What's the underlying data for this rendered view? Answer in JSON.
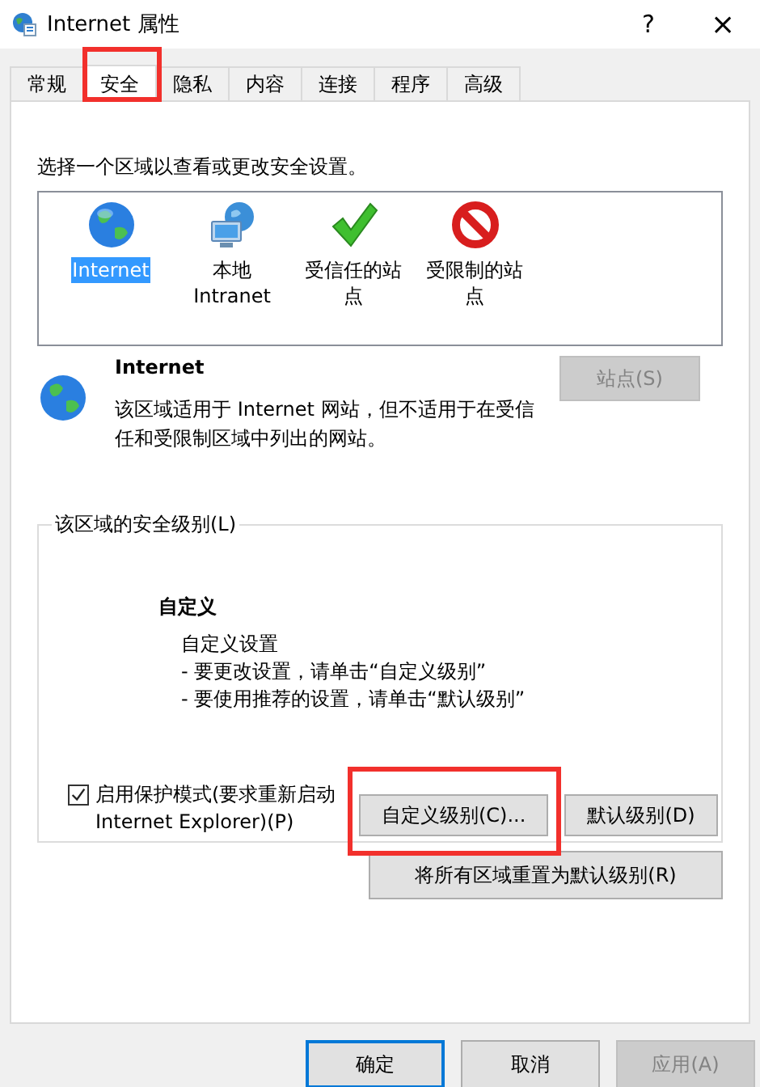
{
  "window": {
    "title": "Internet 属性",
    "help": "?",
    "close": "×"
  },
  "tabs": [
    {
      "label": "常规",
      "selected": false,
      "highlighted": false
    },
    {
      "label": "安全",
      "selected": true,
      "highlighted": true
    },
    {
      "label": "隐私",
      "selected": false,
      "highlighted": false
    },
    {
      "label": "内容",
      "selected": false,
      "highlighted": false
    },
    {
      "label": "连接",
      "selected": false,
      "highlighted": false
    },
    {
      "label": "程序",
      "selected": false,
      "highlighted": false
    },
    {
      "label": "高级",
      "selected": false,
      "highlighted": false
    }
  ],
  "instruction": "选择一个区域以查看或更改安全设置。",
  "zones": [
    {
      "kind": "internet",
      "label": "Internet",
      "selected": true
    },
    {
      "kind": "intranet",
      "label": "本地 Intranet",
      "selected": false
    },
    {
      "kind": "trusted",
      "label": "受信任的站点",
      "selected": false
    },
    {
      "kind": "restricted",
      "label": "受限制的站点",
      "selected": false
    }
  ],
  "zone_detail": {
    "kind": "internet",
    "title": "Internet",
    "description": "该区域适用于 Internet 网站，但不适用于在受信任和受限制区域中列出的网站。",
    "sites_button": {
      "label": "站点(S)",
      "disabled": true
    }
  },
  "security_level": {
    "legend": "该区域的安全级别(L)",
    "level_name": "自定义",
    "lines": [
      "自定义设置",
      "- 要更改设置，请单击“自定义级别”",
      "- 要使用推荐的设置，请单击“默认级别”"
    ],
    "protected_mode": {
      "label": "启用保护模式(要求重新启动 Internet Explorer)(P)",
      "checked": true
    },
    "buttons": [
      {
        "label": "自定义级别(C)...",
        "highlighted": true
      },
      {
        "label": "默认级别(D)",
        "highlighted": false
      }
    ]
  },
  "reset_button": {
    "label": "将所有区域重置为默认级别(R)"
  },
  "footer_buttons": [
    {
      "label": "确定",
      "default": true,
      "disabled": false
    },
    {
      "label": "取消",
      "default": false,
      "disabled": false
    },
    {
      "label": "应用(A)",
      "default": false,
      "disabled": true
    }
  ]
}
